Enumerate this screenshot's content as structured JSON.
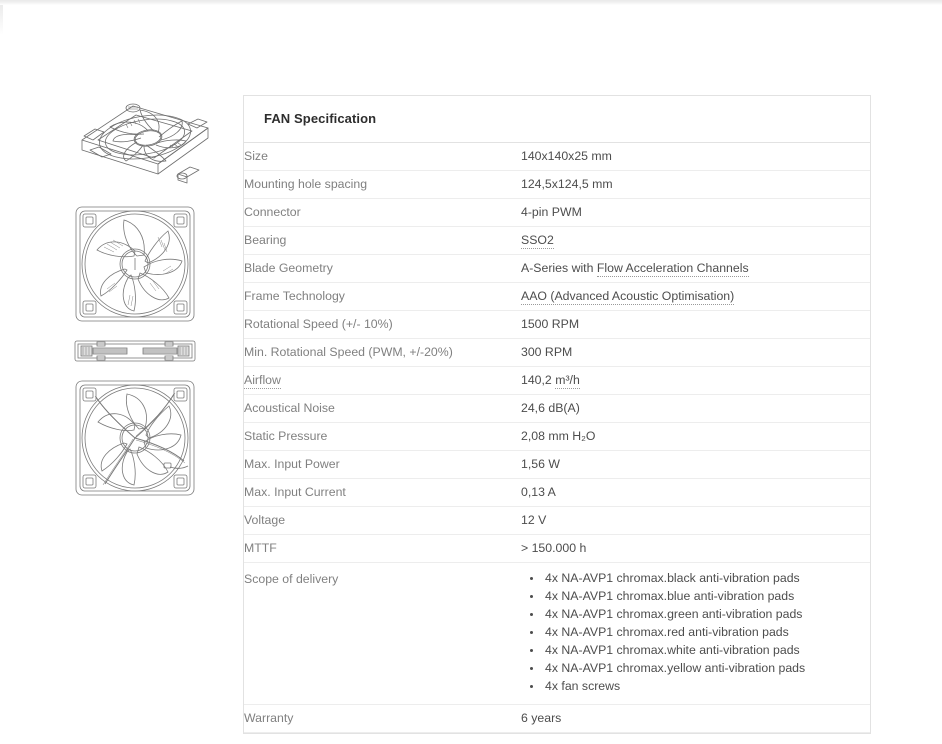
{
  "panel": {
    "title": "FAN Specification"
  },
  "gallery": {
    "items": [
      {
        "name": "fan-isometric-view",
        "alt": "Fan isometric view line drawing"
      },
      {
        "name": "fan-front-view",
        "alt": "Fan front view line drawing"
      },
      {
        "name": "fan-side-profile-view",
        "alt": "Fan side profile line drawing"
      },
      {
        "name": "fan-rear-view",
        "alt": "Fan rear view line drawing"
      }
    ]
  },
  "spec": {
    "rows": [
      {
        "label": "Size",
        "value": "140x140x25 mm"
      },
      {
        "label": "Mounting hole spacing",
        "value": "124,5x124,5 mm"
      },
      {
        "label": "Connector",
        "value": "4-pin PWM"
      },
      {
        "label": "Bearing",
        "value": "SSO2",
        "value_dotted": "SSO2"
      },
      {
        "label": "Blade Geometry",
        "value": "A-Series with Flow Acceleration Channels",
        "value_prefix": "A-Series with ",
        "value_dotted": "Flow Acceleration Channels"
      },
      {
        "label": "Frame Technology",
        "value": "AAO (Advanced Acoustic Optimisation)",
        "value_dotted": "AAO (Advanced Acoustic Optimisation)"
      },
      {
        "label": "Rotational Speed (+/- 10%)",
        "value": "1500 RPM"
      },
      {
        "label": "Min. Rotational Speed (PWM, +/-20%)",
        "value": "300 RPM"
      },
      {
        "label": "Airflow",
        "label_dotted": "Airflow",
        "value": "140,2 m³/h",
        "value_prefix": "140,2 ",
        "value_dotted": "m³/h"
      },
      {
        "label": "Acoustical Noise",
        "value": "24,6 dB(A)"
      },
      {
        "label": "Static Pressure",
        "value": "2,08 mm H₂O"
      },
      {
        "label": "Max. Input Power",
        "value": "1,56 W"
      },
      {
        "label": "Max. Input Current",
        "value": "0,13 A"
      },
      {
        "label": "Voltage",
        "value": "12 V"
      },
      {
        "label": "MTTF",
        "value": "> 150.000 h"
      }
    ],
    "scope": {
      "label": "Scope of delivery",
      "items": [
        "4x NA-AVP1 chromax.black anti-vibration pads",
        "4x NA-AVP1 chromax.blue anti-vibration pads",
        "4x NA-AVP1 chromax.green anti-vibration pads",
        "4x NA-AVP1 chromax.red anti-vibration pads",
        "4x NA-AVP1 chromax.white anti-vibration pads",
        "4x NA-AVP1 chromax.yellow anti-vibration pads",
        "4x fan screws"
      ]
    },
    "warranty": {
      "label": "Warranty",
      "value": "6 years"
    }
  },
  "colors": {
    "label_text": "#808080",
    "value_text": "#4d4d4d",
    "title_text": "#2e2e2e",
    "panel_border": "#e2e2e2",
    "row_divider": "#ededed",
    "line_art": "#6e6e6e"
  }
}
